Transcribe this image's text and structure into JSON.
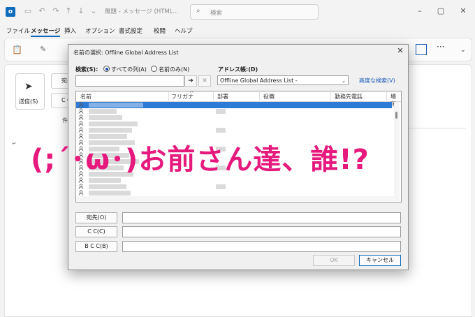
{
  "window": {
    "title": "無題 - メッセージ (HTML...",
    "search_placeholder": "検索"
  },
  "menu": [
    "ファイル",
    "メッセージ",
    "挿入",
    "オプション",
    "書式設定",
    "校閲",
    "ヘルプ"
  ],
  "compose": {
    "send_label": "送信(S)",
    "to_label": "宛先",
    "cc_label": "C C",
    "subject_label": "件名"
  },
  "dialog": {
    "title": "名前の選択: Offline Global Address List",
    "search_label": "検索(S):",
    "radio_all": "すべての列(A)",
    "radio_name": "名前のみ(N)",
    "addressbook_label": "アドレス帳:(D)",
    "addressbook_value": "Offline Global Address List -",
    "advanced_link": "高度な検索(V)",
    "columns": [
      "名前",
      "フリガナ",
      "部署",
      "役職",
      "勤務先電話",
      "場所"
    ],
    "to_button": "宛先(O)",
    "cc_button": "C C(C)",
    "bcc_button": "B C C(B)",
    "ok_button": "OK",
    "cancel_button": "キャンセル"
  },
  "overlay_text": "(;´･ω･)お前さん達、誰!?"
}
